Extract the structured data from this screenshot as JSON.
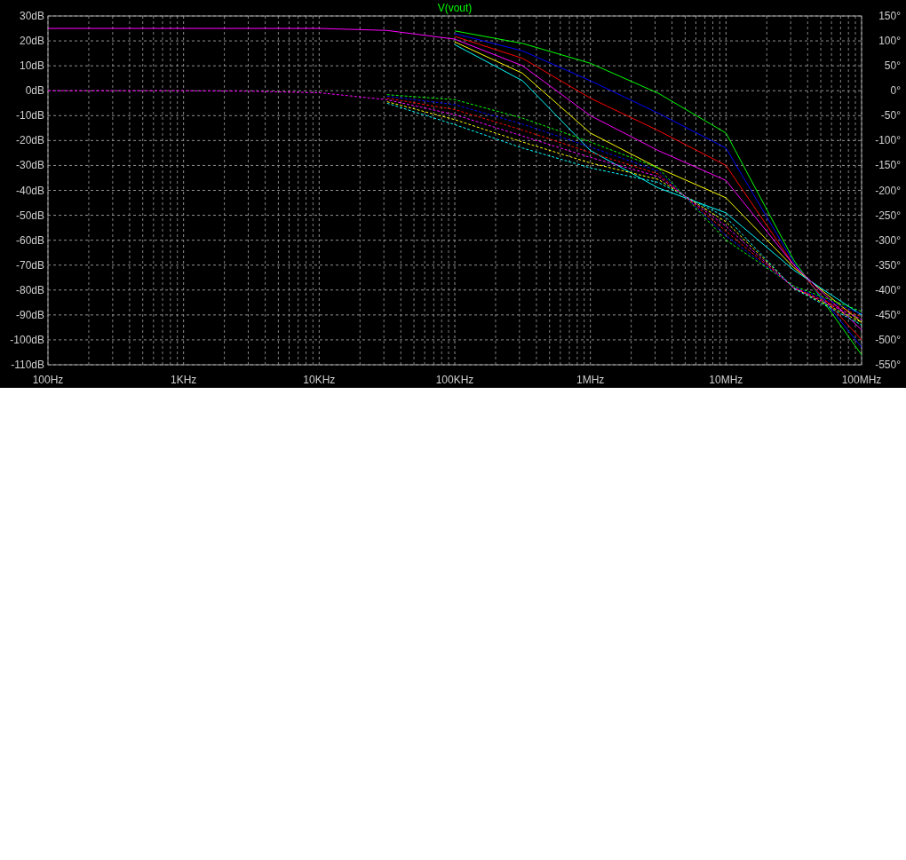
{
  "plot": {
    "chart_data": {
      "type": "line",
      "title": "V(vout)",
      "categories": [
        "100Hz",
        null,
        "1KHz",
        null,
        "10KHz",
        null,
        "100KHz",
        null,
        "1MHz",
        null,
        "10MHz",
        null,
        "100MHz"
      ],
      "grid": true,
      "ylim": [
        -110,
        30
      ],
      "yticks": [
        {
          "value": 30,
          "label": "30dB"
        },
        {
          "value": 20,
          "label": "20dB"
        },
        {
          "value": 10,
          "label": "10dB"
        },
        {
          "value": 0,
          "label": "0dB"
        },
        {
          "value": -10,
          "label": "-10dB"
        },
        {
          "value": -20,
          "label": "-20dB"
        },
        {
          "value": -30,
          "label": "-30dB"
        },
        {
          "value": -40,
          "label": "-40dB"
        },
        {
          "value": -50,
          "label": "-50dB"
        },
        {
          "value": -60,
          "label": "-60dB"
        },
        {
          "value": -70,
          "label": "-70dB"
        },
        {
          "value": -80,
          "label": "-80dB"
        },
        {
          "value": -90,
          "label": "-90dB"
        },
        {
          "value": -100,
          "label": "-100dB"
        },
        {
          "value": -110,
          "label": "-110dB"
        }
      ],
      "y2lim": [
        -550,
        150
      ],
      "y2ticks": [
        {
          "value": 150,
          "label": "150°"
        },
        {
          "value": 100,
          "label": "100°"
        },
        {
          "value": 50,
          "label": "50°"
        },
        {
          "value": 0,
          "label": "0°"
        },
        {
          "value": -50,
          "label": "-50°"
        },
        {
          "value": -100,
          "label": "-100°"
        },
        {
          "value": -150,
          "label": "-150°"
        },
        {
          "value": -200,
          "label": "-200°"
        },
        {
          "value": -250,
          "label": "-250°"
        },
        {
          "value": -300,
          "label": "-300°"
        },
        {
          "value": -350,
          "label": "-350°"
        },
        {
          "value": -400,
          "label": "-400°"
        },
        {
          "value": -450,
          "label": "-450°"
        },
        {
          "value": -500,
          "label": "-500°"
        },
        {
          "value": -550,
          "label": "-550°"
        }
      ],
      "series": [
        {
          "color": "#00ff00",
          "values": [
            null,
            null,
            null,
            null,
            null,
            null,
            24,
            19,
            11,
            -1,
            -17,
            -68,
            -106
          ]
        },
        {
          "color": "#0000ff",
          "values": [
            null,
            null,
            null,
            null,
            null,
            null,
            22.9,
            16,
            4,
            -9,
            -23,
            -69,
            -103
          ]
        },
        {
          "color": "#ff0000",
          "values": [
            null,
            null,
            null,
            null,
            null,
            null,
            21.8,
            13,
            -3,
            -16,
            -30,
            -70,
            -100
          ]
        },
        {
          "color": "#ffff00",
          "values": [
            null,
            null,
            null,
            null,
            null,
            null,
            19.6,
            7,
            -17,
            -31,
            -43,
            -71,
            -93
          ]
        },
        {
          "color": "#00ffff",
          "values": [
            null,
            null,
            null,
            null,
            null,
            null,
            18.5,
            4,
            -24,
            -39,
            -49,
            -72,
            -90
          ]
        },
        {
          "color": "#ff00ff",
          "values": [
            25,
            25,
            25,
            25,
            25,
            24.2,
            20.7,
            10,
            -10,
            -24,
            -36,
            -70,
            -96
          ]
        },
        {
          "axis": "y2",
          "line_style": "dashed",
          "color": "#00ff00",
          "values": [
            null,
            null,
            null,
            null,
            null,
            -8,
            -18,
            -55,
            -103,
            -155,
            -300,
            -392,
            -443
          ]
        },
        {
          "axis": "y2",
          "line_style": "dashed",
          "color": "#0000ff",
          "values": [
            null,
            null,
            null,
            null,
            null,
            -11,
            -28,
            -67,
            -113,
            -161,
            -291,
            -394,
            -448
          ]
        },
        {
          "axis": "y2",
          "line_style": "dashed",
          "color": "#ff0000",
          "values": [
            null,
            null,
            null,
            null,
            null,
            -15,
            -38,
            -79,
            -124,
            -167,
            -282,
            -395,
            -454
          ]
        },
        {
          "axis": "y2",
          "line_style": "dashed",
          "color": "#ffff00",
          "values": [
            null,
            null,
            null,
            null,
            null,
            -22,
            -58,
            -103,
            -145,
            -178,
            -263,
            -396,
            -465
          ]
        },
        {
          "axis": "y2",
          "line_style": "dashed",
          "color": "#00ffff",
          "values": [
            null,
            null,
            null,
            null,
            null,
            -25,
            -68,
            -115,
            -155,
            -184,
            -254,
            -397,
            -470
          ]
        },
        {
          "axis": "y2",
          "line_style": "dashed",
          "color": "#ff00ff",
          "values": [
            0,
            0,
            0,
            -1,
            -4,
            -18,
            -48,
            -91,
            -134,
            -172,
            -272,
            -396,
            -459
          ]
        }
      ]
    }
  }
}
